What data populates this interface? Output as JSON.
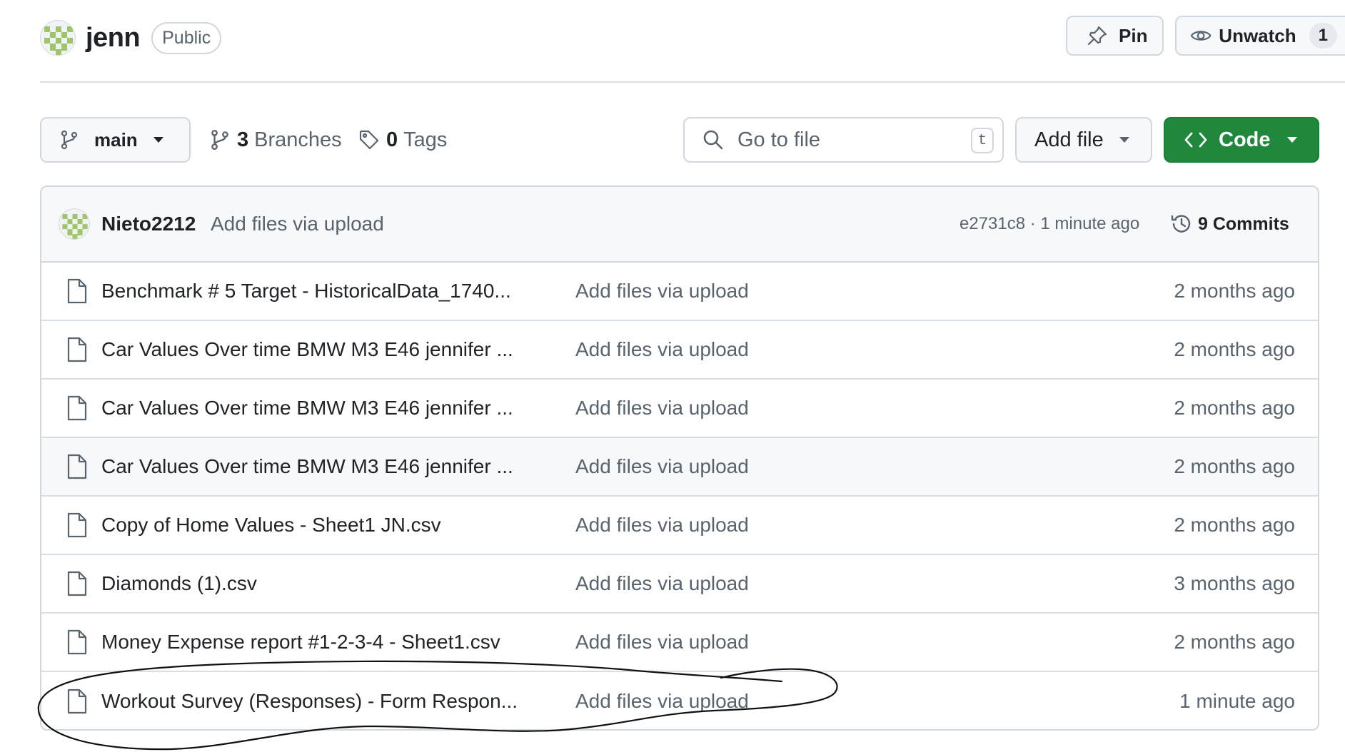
{
  "repo": {
    "name": "jenn",
    "visibility": "Public"
  },
  "header_actions": {
    "pin_label": "Pin",
    "watch_label": "Unwatch",
    "watch_count": "1"
  },
  "toolbar": {
    "branch": "main",
    "branches_count": "3",
    "branches_label": "Branches",
    "tags_count": "0",
    "tags_label": "Tags",
    "search_placeholder": "Go to file",
    "search_shortcut": "t",
    "add_file_label": "Add file",
    "code_label": "Code",
    "code_color": "#1f883d"
  },
  "latest_commit": {
    "author": "Nieto2212",
    "message": "Add files via upload",
    "meta": "e2731c8 · 1 minute ago",
    "commits_label": "9 Commits"
  },
  "files": [
    {
      "name": "Benchmark # 5 Target - HistoricalData_1740...",
      "commit": "Add files via upload",
      "age": "2 months ago"
    },
    {
      "name": "Car Values Over time BMW M3 E46 jennifer ...",
      "commit": "Add files via upload",
      "age": "2 months ago"
    },
    {
      "name": "Car Values Over time BMW M3 E46 jennifer ...",
      "commit": "Add files via upload",
      "age": "2 months ago"
    },
    {
      "name": "Car Values Over time BMW M3 E46 jennifer ...",
      "commit": "Add files via upload",
      "age": "2 months ago"
    },
    {
      "name": "Copy of Home Values - Sheet1 JN.csv",
      "commit": "Add files via upload",
      "age": "2 months ago"
    },
    {
      "name": "Diamonds (1).csv",
      "commit": "Add files via upload",
      "age": "3 months ago"
    },
    {
      "name": "Money Expense report #1-2-3-4 - Sheet1.csv",
      "commit": "Add files via upload",
      "age": "2 months ago"
    },
    {
      "name": "Workout Survey (Responses) - Form Respon...",
      "commit": "Add files via upload",
      "age": "1 minute ago"
    }
  ],
  "icons": {
    "avatar": "identicon-avatar",
    "pin": "pin-icon",
    "watch": "eye-icon",
    "branch": "git-branch-icon",
    "tag": "tag-icon",
    "search": "search-icon",
    "code": "code-icon",
    "history": "history-icon",
    "file": "file-icon"
  },
  "annotation": "hand-drawn ink circle around the Workout Survey row"
}
